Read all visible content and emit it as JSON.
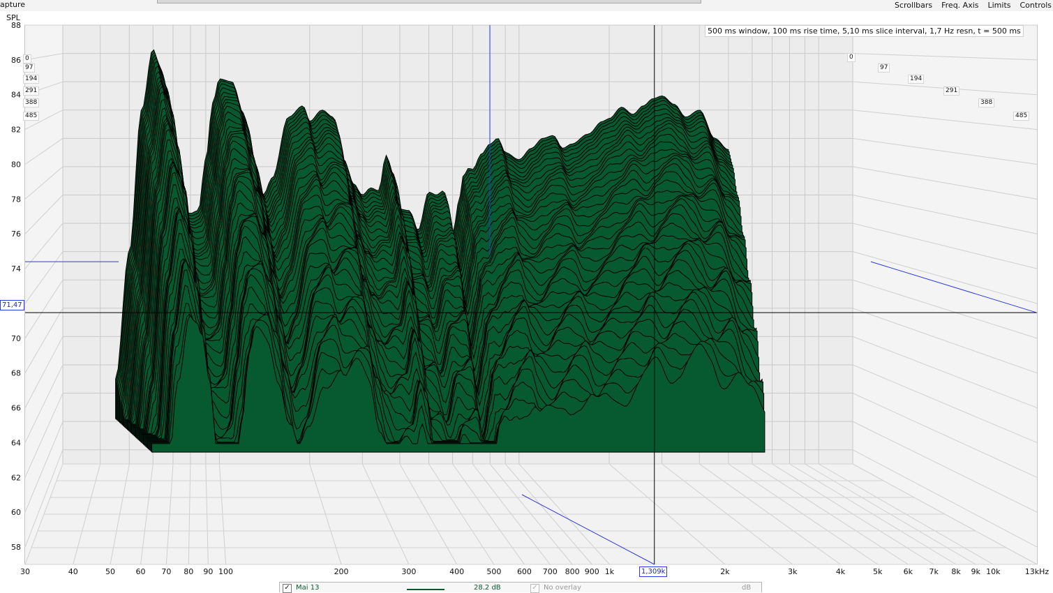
{
  "app": {
    "title": "apture"
  },
  "menu": [
    "Scrollbars",
    "Freq. Axis",
    "Limits",
    "Controls"
  ],
  "info": "500 ms window, 100 ms rise time, 5,10 ms slice interval, 1,7 Hz resn, t = 500 ms",
  "cursor": {
    "y_readout": "71,47",
    "x_readout": "1,309k",
    "y_value": 71.47,
    "x_value": 1309
  },
  "legend": {
    "measurement": "Mai 13",
    "range": "28.2 dB",
    "overlay": "No overlay",
    "overlay_unit": "dB"
  },
  "chart_data": {
    "type": "area",
    "subtype": "waterfall-3d",
    "xlabel": "",
    "ylabel": "SPL",
    "x_scale": "log",
    "xlim": [
      30,
      13000
    ],
    "ylim": [
      57,
      88
    ],
    "grid": true,
    "fill_color": "#075a30",
    "ridge_color": "#000000",
    "x_ticks": [
      30,
      40,
      50,
      60,
      70,
      80,
      90,
      100,
      200,
      300,
      400,
      500,
      600,
      700,
      800,
      900,
      1000,
      2000,
      3000,
      4000,
      5000,
      6000,
      7000,
      8000,
      9000,
      10000,
      13000
    ],
    "x_tick_labels": [
      "30",
      "40",
      "50",
      "60",
      "70",
      "80",
      "90",
      "100",
      "200",
      "300",
      "400",
      "500",
      "600",
      "700",
      "800",
      "900",
      "1k",
      "2k",
      "3k",
      "4k",
      "5k",
      "6k",
      "7k",
      "8k",
      "9k",
      "10k",
      "13kHz"
    ],
    "y_ticks": [
      58,
      60,
      62,
      64,
      66,
      68,
      70,
      72,
      74,
      76,
      78,
      80,
      82,
      84,
      86,
      88
    ],
    "y_tick_labels": [
      "58",
      "60",
      "62",
      "64",
      "66",
      "68",
      "70",
      "72",
      "74",
      "76",
      "78",
      "80",
      "82",
      "84",
      "86",
      "88"
    ],
    "slice_labels": [
      "0",
      "97",
      "194",
      "291",
      "388",
      "485"
    ],
    "series": [
      {
        "x": [
          45,
          50,
          55,
          60,
          63,
          66,
          70,
          75,
          80,
          85,
          90,
          95,
          100,
          110,
          120,
          130,
          140,
          150,
          170,
          190,
          200,
          220,
          240,
          260,
          280,
          300,
          320,
          340,
          360,
          380,
          400,
          430,
          460,
          500,
          530,
          560,
          600,
          630,
          650,
          680,
          700,
          750,
          800,
          850,
          900,
          1000,
          1100,
          1200,
          1300,
          1400,
          1500,
          1700,
          1900,
          2000,
          2200,
          2400,
          2600,
          2800,
          3000,
          3300,
          3600,
          4000,
          4500,
          5000
        ],
        "values": [
          63,
          72,
          82,
          86.3,
          85.2,
          83.8,
          80.5,
          75.0,
          74.7,
          74.9,
          78.5,
          82.5,
          84.2,
          84.0,
          81.8,
          78.5,
          76.0,
          77.2,
          81.5,
          82.3,
          81.2,
          82.0,
          81.5,
          78.5,
          76.8,
          76.0,
          76.5,
          76.3,
          78.8,
          77.5,
          75.0,
          74.9,
          73.5,
          76.2,
          76.0,
          76.3,
          73.2,
          75.5,
          77.3,
          77.9,
          77.8,
          78.9,
          79.6,
          80.0,
          79.0,
          78.5,
          79.3,
          80.0,
          80.2,
          79.3,
          79.6,
          80.3,
          81.2,
          81.4,
          82.2,
          81.7,
          82.3,
          82.8,
          83.0,
          82.4,
          81.5,
          82.0,
          80.0,
          79.2
        ]
      }
    ],
    "cursor_readout": {
      "x": 1309,
      "y": 71.47
    }
  }
}
